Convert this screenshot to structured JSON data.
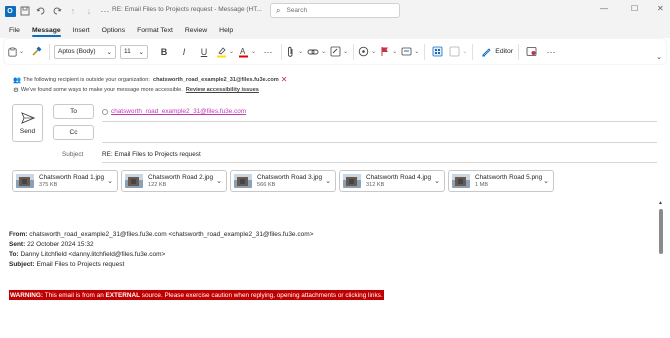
{
  "titlebar": {
    "title": "RE: Email Files to Projects request  -  Message (HT...",
    "search_placeholder": "Search",
    "app_icon_letter": "O"
  },
  "menu": {
    "tabs": [
      "File",
      "Message",
      "Insert",
      "Options",
      "Format Text",
      "Review",
      "Help"
    ],
    "active": "Message"
  },
  "ribbon": {
    "font_name": "Aptos (Body)",
    "font_size": "11",
    "bold": "B",
    "italic": "I",
    "underline": "U",
    "editor_label": "Editor",
    "more": "···"
  },
  "info": {
    "recipient_warning_prefix": "The following recipient is outside your organization:",
    "recipient_warning_email": "chatsworth_road_example2_31@files.fu3e.com",
    "accessibility_text": "We've found some ways to make your message more accessible.",
    "accessibility_link": "Review accessibility issues"
  },
  "compose": {
    "send_label": "Send",
    "to_label": "To",
    "cc_label": "Cc",
    "to_value": "chatsworth_road_example2_31@files.fu3e.com",
    "subject_label": "Subject",
    "subject_value": "RE: Email Files to Projects request"
  },
  "attachments": [
    {
      "name": "Chatsworth Road 1.jpg",
      "size": "375 KB"
    },
    {
      "name": "Chatsworth Road 2.jpg",
      "size": "122 KB"
    },
    {
      "name": "Chatsworth Road 3.jpg",
      "size": "566 KB"
    },
    {
      "name": "Chatsworth Road 4.jpg",
      "size": "312 KB"
    },
    {
      "name": "Chatsworth Road 5.png",
      "size": "1 MB"
    }
  ],
  "body": {
    "from_label": "From:",
    "from_value": "chatsworth_road_example2_31@files.fu3e.com <chatsworth_road_example2_31@files.fu3e.com>",
    "sent_label": "Sent:",
    "sent_value": "22 October 2024 15:32",
    "to_label": "To:",
    "to_value": "Danny Litchfield <danny.litchfield@files.fu3e.com>",
    "subject_label": "Subject:",
    "subject_value": "Email Files to Projects request",
    "warning_label": "WARNING:",
    "warning_pre": "This email is from an",
    "warning_external": "EXTERNAL",
    "warning_post": "source. Please exercise caution when replying, opening attachments or clicking links."
  }
}
